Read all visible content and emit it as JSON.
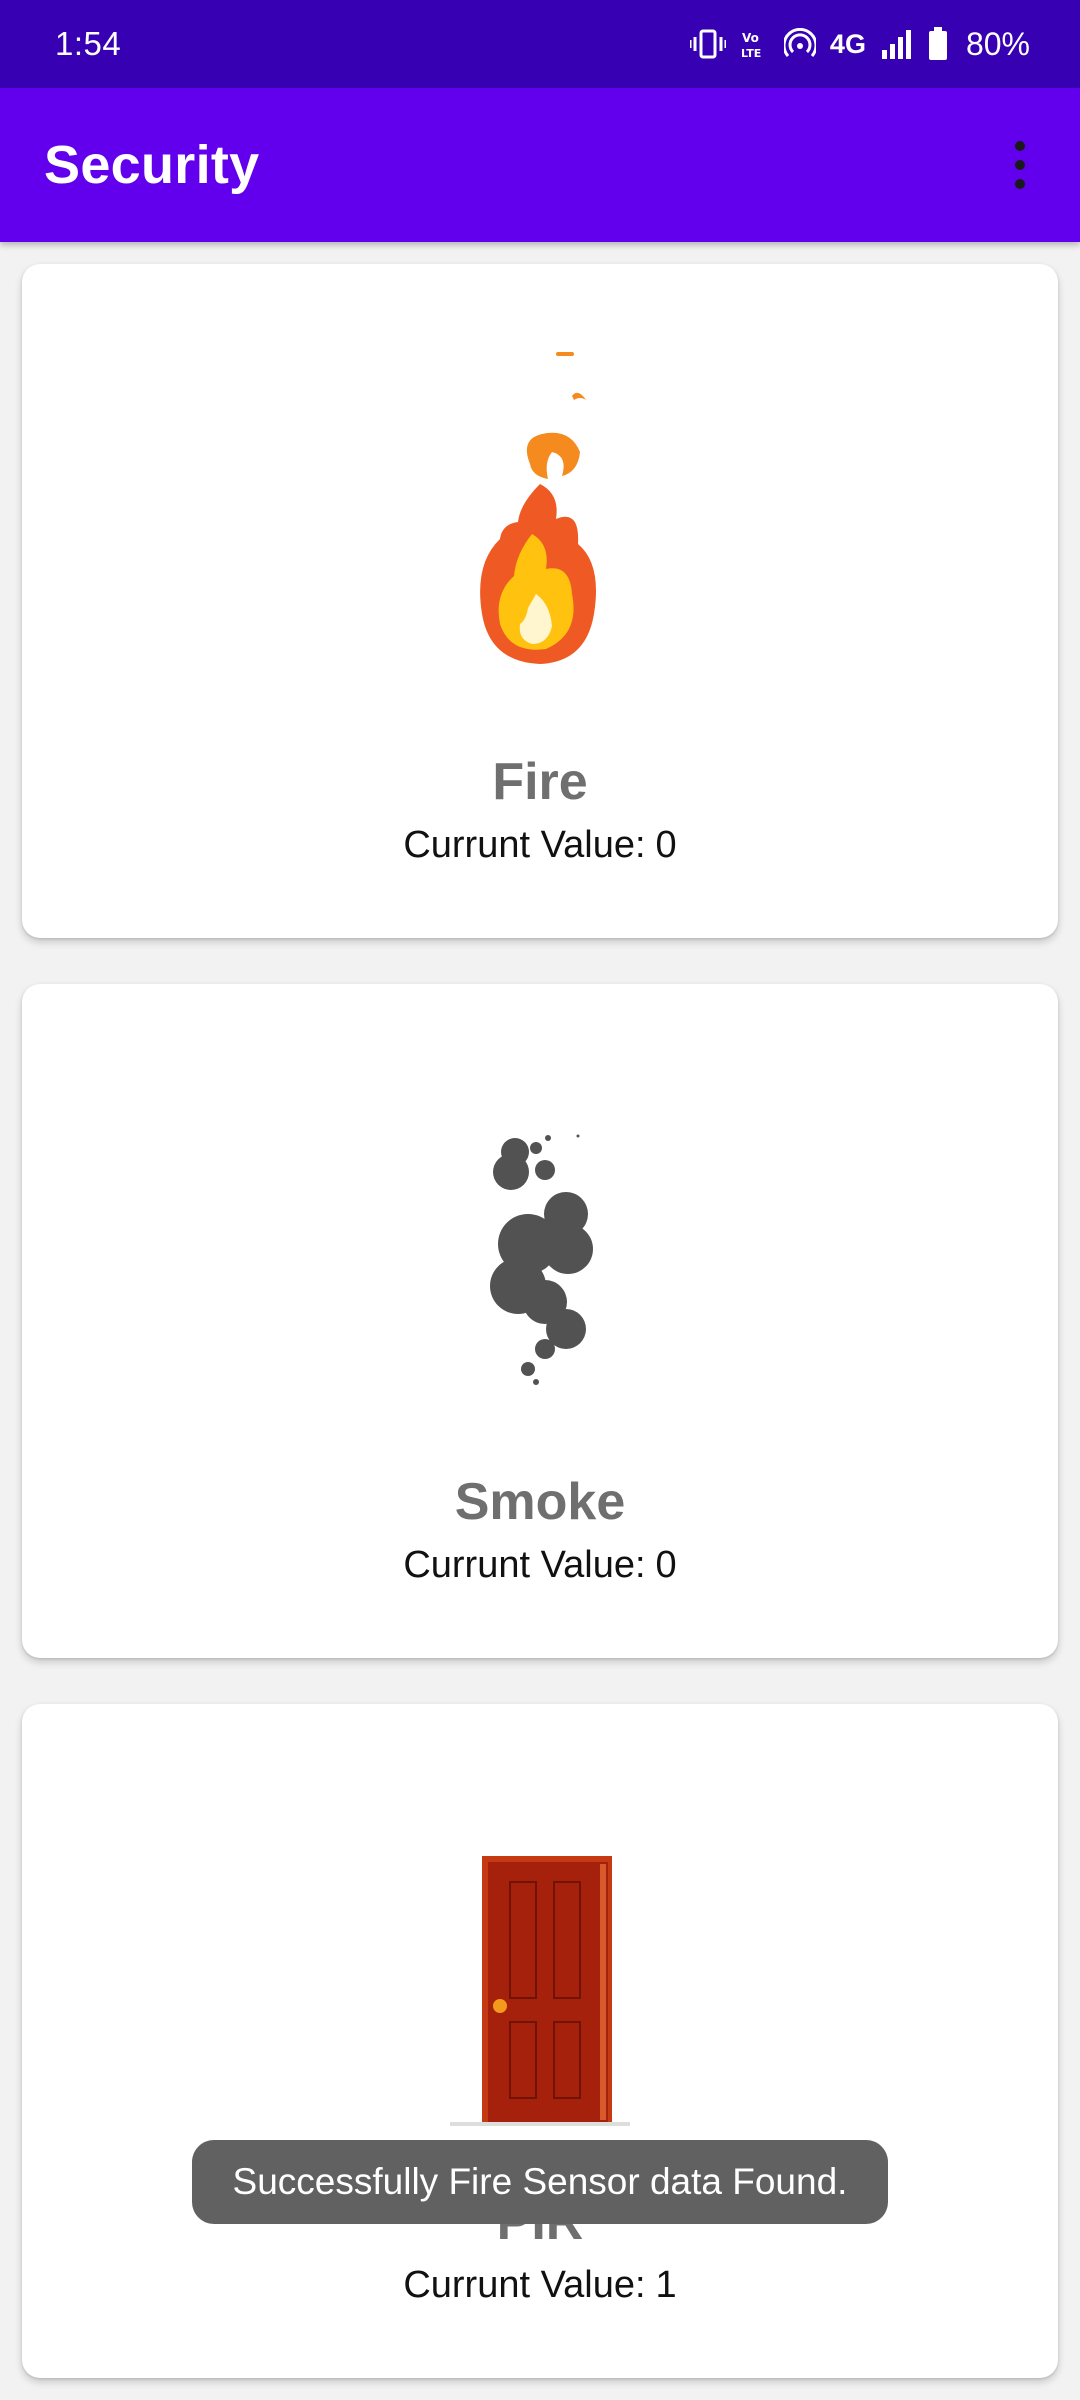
{
  "status_bar": {
    "time": "1:54",
    "network": "4G",
    "battery": "80%",
    "icons": [
      "vibrate-icon",
      "volte-icon",
      "hotspot-icon",
      "signal-icon",
      "battery-icon"
    ]
  },
  "app_bar": {
    "title": "Security",
    "menu_icon": "overflow-menu-icon"
  },
  "cards": [
    {
      "name": "Fire",
      "value_label": "Currunt Value:",
      "value": "0",
      "icon": "fire-icon"
    },
    {
      "name": "Smoke",
      "value_label": "Currunt Value:",
      "value": "0",
      "icon": "smoke-icon"
    },
    {
      "name": "PIR",
      "value_label": "Currunt Value:",
      "value": "1",
      "icon": "door-icon"
    }
  ],
  "toast": {
    "message": "Successfully Fire Sensor data Found."
  },
  "colors": {
    "status_bar": "#3700b3",
    "app_bar": "#6200ee",
    "toast": "#616161"
  }
}
